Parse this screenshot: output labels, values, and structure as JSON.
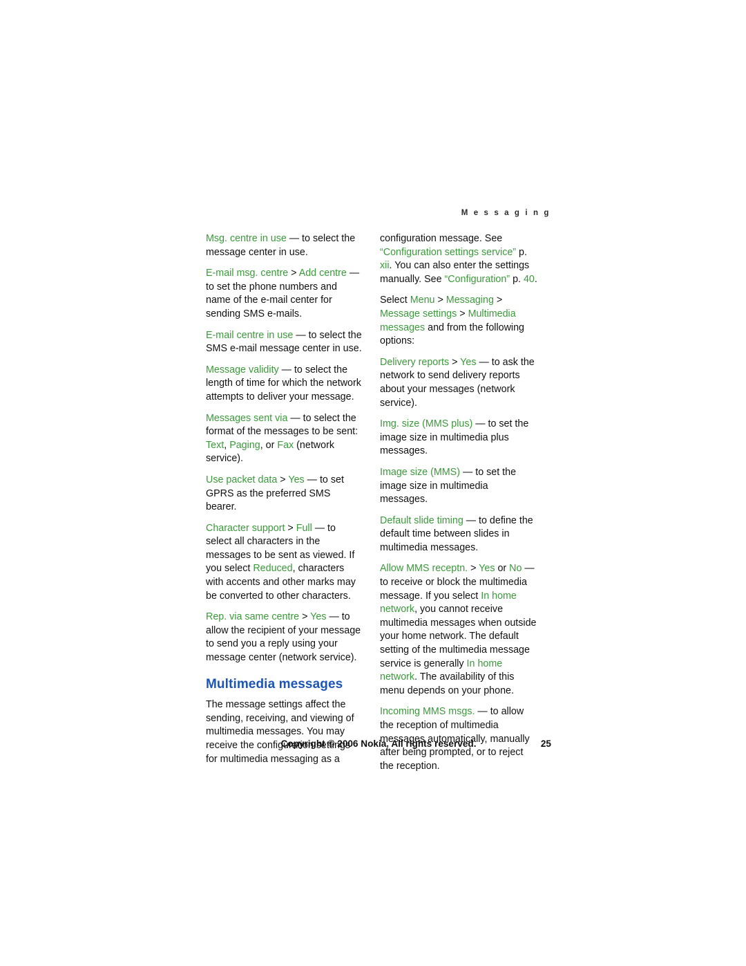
{
  "header": {
    "running_head": "M e s s a g i n g"
  },
  "colors": {
    "green_term": "#3a9a3a",
    "blue_heading": "#1b55b8",
    "body_text": "#101010"
  },
  "left_column": [
    {
      "id": "msg-centre-in-use",
      "parts": [
        {
          "text": "Msg. centre in use",
          "style": "green"
        },
        {
          "text": " — to select the message center in use.",
          "style": "plain"
        }
      ]
    },
    {
      "id": "email-msg-centre",
      "parts": [
        {
          "text": "E-mail msg. centre",
          "style": "green"
        },
        {
          "text": " > ",
          "style": "plain"
        },
        {
          "text": "Add centre",
          "style": "green"
        },
        {
          "text": " — to set the phone numbers and name of the e-mail center for sending SMS e-mails.",
          "style": "plain"
        }
      ]
    },
    {
      "id": "email-centre-in-use",
      "parts": [
        {
          "text": "E-mail centre in use",
          "style": "green"
        },
        {
          "text": " — to select the SMS e-mail message center in use.",
          "style": "plain"
        }
      ]
    },
    {
      "id": "message-validity",
      "parts": [
        {
          "text": "Message validity",
          "style": "green"
        },
        {
          "text": " — to select the length of time for which the network attempts to deliver your message.",
          "style": "plain"
        }
      ]
    },
    {
      "id": "messages-sent-via",
      "parts": [
        {
          "text": "Messages sent via",
          "style": "green"
        },
        {
          "text": " — to select the format of the messages to be sent: ",
          "style": "plain"
        },
        {
          "text": "Text",
          "style": "green"
        },
        {
          "text": ", ",
          "style": "plain"
        },
        {
          "text": "Paging",
          "style": "green"
        },
        {
          "text": ", or ",
          "style": "plain"
        },
        {
          "text": "Fax",
          "style": "green"
        },
        {
          "text": " (network service).",
          "style": "plain"
        }
      ]
    },
    {
      "id": "use-packet-data",
      "parts": [
        {
          "text": "Use packet data",
          "style": "green"
        },
        {
          "text": " > ",
          "style": "plain"
        },
        {
          "text": "Yes",
          "style": "green"
        },
        {
          "text": " — to set GPRS as the preferred SMS bearer.",
          "style": "plain"
        }
      ]
    },
    {
      "id": "character-support",
      "parts": [
        {
          "text": "Character support",
          "style": "green"
        },
        {
          "text": " > ",
          "style": "plain"
        },
        {
          "text": "Full",
          "style": "green"
        },
        {
          "text": " — to select all characters in the messages to be sent as viewed. If you select ",
          "style": "plain"
        },
        {
          "text": "Reduced",
          "style": "green"
        },
        {
          "text": ", characters with accents and other marks may be converted to other characters.",
          "style": "plain"
        }
      ]
    },
    {
      "id": "rep-via-same-centre",
      "parts": [
        {
          "text": "Rep. via same centre",
          "style": "green"
        },
        {
          "text": " > ",
          "style": "plain"
        },
        {
          "text": "Yes",
          "style": "green"
        },
        {
          "text": " — to allow the recipient of your message to send you a reply using your message center (network service).",
          "style": "plain"
        }
      ]
    }
  ],
  "section_heading": "Multimedia messages",
  "left_column_after_heading": [
    {
      "id": "multimedia-intro",
      "parts": [
        {
          "text": "The message settings affect the sending, receiving, and viewing of multimedia messages. You may receive the configuration settings for multimedia messaging as a",
          "style": "plain"
        }
      ]
    }
  ],
  "right_column": [
    {
      "id": "config-message",
      "parts": [
        {
          "text": "configuration message. See ",
          "style": "plain"
        },
        {
          "text": "“Configuration settings service”",
          "style": "green"
        },
        {
          "text": " p. ",
          "style": "plain"
        },
        {
          "text": "xii",
          "style": "green"
        },
        {
          "text": ". You can also enter the settings manually. See ",
          "style": "plain"
        },
        {
          "text": "“Configuration”",
          "style": "green"
        },
        {
          "text": " p. ",
          "style": "plain"
        },
        {
          "text": "40",
          "style": "green"
        },
        {
          "text": ".",
          "style": "plain"
        }
      ]
    },
    {
      "id": "select-menu-path",
      "parts": [
        {
          "text": "Select ",
          "style": "plain"
        },
        {
          "text": "Menu",
          "style": "green"
        },
        {
          "text": " > ",
          "style": "plain"
        },
        {
          "text": "Messaging",
          "style": "green"
        },
        {
          "text": " > ",
          "style": "plain"
        },
        {
          "text": "Message settings",
          "style": "green"
        },
        {
          "text": " > ",
          "style": "plain"
        },
        {
          "text": "Multimedia messages",
          "style": "green"
        },
        {
          "text": " and from the following options:",
          "style": "plain"
        }
      ]
    },
    {
      "id": "delivery-reports",
      "parts": [
        {
          "text": "Delivery reports",
          "style": "green"
        },
        {
          "text": " > ",
          "style": "plain"
        },
        {
          "text": "Yes",
          "style": "green"
        },
        {
          "text": " — to ask the network to send delivery reports about your messages (network service).",
          "style": "plain"
        }
      ]
    },
    {
      "id": "img-size-mms-plus",
      "parts": [
        {
          "text": "Img. size (MMS plus)",
          "style": "green"
        },
        {
          "text": " — to set the image size in multimedia plus messages.",
          "style": "plain"
        }
      ]
    },
    {
      "id": "image-size-mms",
      "parts": [
        {
          "text": "Image size (MMS)",
          "style": "green"
        },
        {
          "text": " — to set the image size in multimedia messages.",
          "style": "plain"
        }
      ]
    },
    {
      "id": "default-slide-timing",
      "parts": [
        {
          "text": "Default slide timing",
          "style": "green"
        },
        {
          "text": " — to define the default time between slides in multimedia messages.",
          "style": "plain"
        }
      ]
    },
    {
      "id": "allow-mms-reception",
      "parts": [
        {
          "text": "Allow MMS receptn.",
          "style": "green"
        },
        {
          "text": " > ",
          "style": "plain"
        },
        {
          "text": "Yes",
          "style": "green"
        },
        {
          "text": " or ",
          "style": "plain"
        },
        {
          "text": "No",
          "style": "green"
        },
        {
          "text": " — to receive or block the multimedia message. If you select ",
          "style": "plain"
        },
        {
          "text": "In home network",
          "style": "green"
        },
        {
          "text": ", you cannot receive multimedia messages when outside your home network. The default setting of the multimedia message service is generally ",
          "style": "plain"
        },
        {
          "text": "In home network",
          "style": "green"
        },
        {
          "text": ". The availability of this menu depends on your phone.",
          "style": "plain"
        }
      ]
    },
    {
      "id": "incoming-mms-msgs",
      "parts": [
        {
          "text": "Incoming MMS msgs.",
          "style": "green"
        },
        {
          "text": " — to allow the reception of multimedia messages automatically, manually after being prompted, or to reject the reception.",
          "style": "plain"
        }
      ]
    }
  ],
  "footer": {
    "copyright": "Copyright © 2006 Nokia. All rights reserved.",
    "page_number": "25"
  }
}
